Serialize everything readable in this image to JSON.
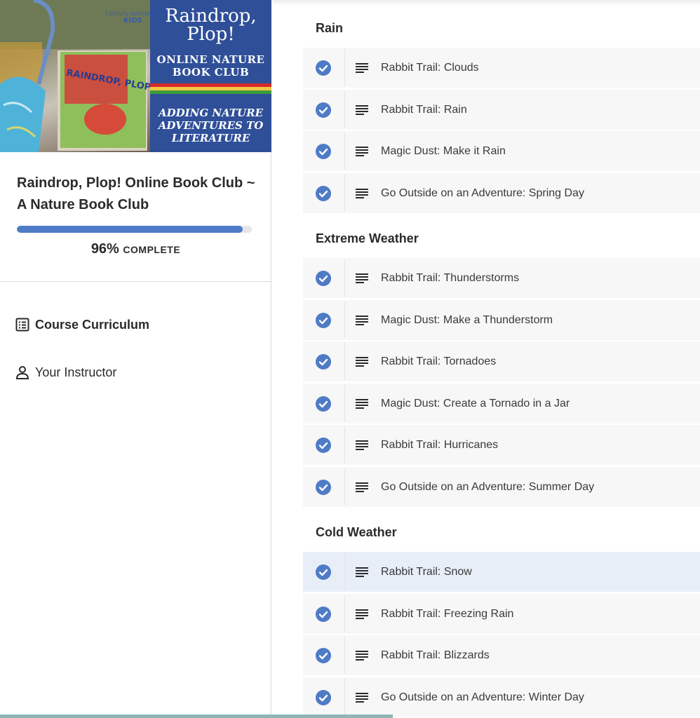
{
  "cover": {
    "publisher": "Literary Adventures for KIDS",
    "book_title": "RAINDROP, PLOP!",
    "title": "Raindrop, Plop!",
    "subtitle": "ONLINE NATURE BOOK CLUB",
    "tagline": "ADDING NATURE ADVENTURES TO LITERATURE",
    "stripe_colors": [
      "#d62a2a",
      "#f2c744",
      "#3c9c3a"
    ]
  },
  "course": {
    "title": "Raindrop, Plop! Online Book Club ~ A Nature Book Club",
    "progress_percent": "96%",
    "progress_fraction": 0.96,
    "complete_label": "COMPLETE"
  },
  "nav": {
    "curriculum_label": "Course Curriculum",
    "instructor_label": "Your Instructor"
  },
  "sections": [
    {
      "title": "Rain",
      "lessons": [
        {
          "label": "Rabbit Trail: Clouds",
          "completed": true
        },
        {
          "label": "Rabbit Trail: Rain",
          "completed": true
        },
        {
          "label": "Magic Dust: Make it Rain",
          "completed": true
        },
        {
          "label": "Go Outside on an Adventure: Spring Day",
          "completed": true
        }
      ]
    },
    {
      "title": "Extreme Weather",
      "lessons": [
        {
          "label": "Rabbit Trail: Thunderstorms",
          "completed": true
        },
        {
          "label": "Magic Dust: Make a Thunderstorm",
          "completed": true
        },
        {
          "label": "Rabbit Trail: Tornadoes",
          "completed": true
        },
        {
          "label": "Magic Dust: Create a Tornado in a Jar",
          "completed": true
        },
        {
          "label": "Rabbit Trail: Hurricanes",
          "completed": true
        },
        {
          "label": "Go Outside on an Adventure: Summer Day",
          "completed": true
        }
      ]
    },
    {
      "title": "Cold Weather",
      "lessons": [
        {
          "label": "Rabbit Trail: Snow",
          "completed": true,
          "active": true
        },
        {
          "label": "Rabbit Trail: Freezing Rain",
          "completed": true
        },
        {
          "label": "Rabbit Trail: Blizzards",
          "completed": true
        },
        {
          "label": "Go Outside on an Adventure: Winter Day",
          "completed": true
        }
      ]
    }
  ],
  "colors": {
    "accent": "#4f7bc6",
    "cover_panel": "#2f4f98",
    "lesson_bg": "#f7f7f7",
    "lesson_active_bg": "#e8eef8"
  },
  "icons": {
    "check": "check-circle-icon",
    "lesson_type": "text-lines-icon",
    "curriculum": "list-icon",
    "instructor": "person-icon"
  }
}
